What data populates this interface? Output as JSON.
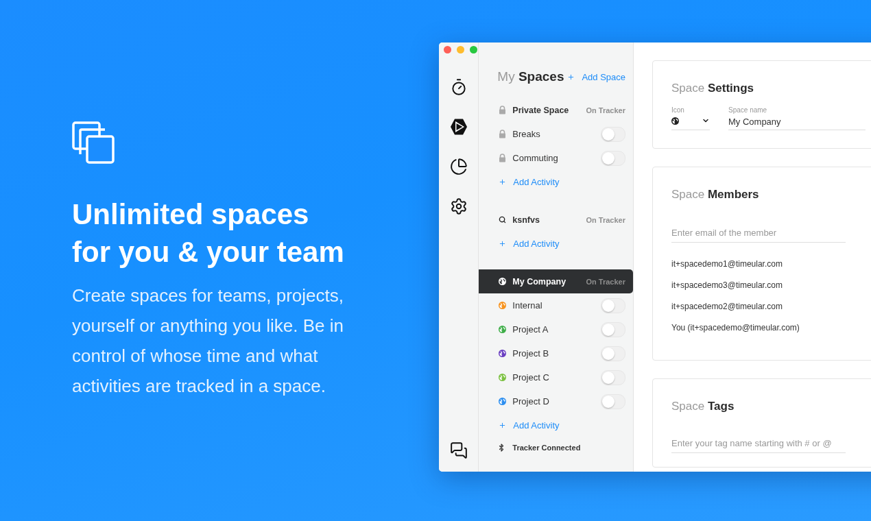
{
  "hero": {
    "heading_lines": [
      "Unlimited spaces",
      "for you & your team"
    ],
    "body": "Create spaces for teams, projects, yourself or anything you like. Be in control of whose time and what activities are tracked in a space."
  },
  "spaces_panel": {
    "title": "My **Spaces**",
    "add_space": "Add Space",
    "groups": [
      {
        "name": "Private Space",
        "kind": "lock",
        "tracker_label": "On Tracker",
        "selected": false,
        "add_label": "Add Activity",
        "activities": [
          {
            "name": "Breaks",
            "kind": "lock",
            "on": false
          },
          {
            "name": "Commuting",
            "kind": "lock",
            "on": false
          }
        ]
      },
      {
        "name": "ksnfvs",
        "kind": "search",
        "tracker_label": "On Tracker",
        "selected": false,
        "add_label": "Add Activity"
      },
      {
        "name": "My Company",
        "kind": "globe",
        "tracker_label": "On Tracker",
        "selected": true,
        "add_label": "Add Activity",
        "activities": [
          {
            "name": "Internal",
            "kind": "globe",
            "color": "#f7931e",
            "on": false
          },
          {
            "name": "Project A",
            "kind": "globe",
            "color": "#3fae49",
            "on": false
          },
          {
            "name": "Project B",
            "kind": "globe",
            "color": "#6a3fc1",
            "on": false
          },
          {
            "name": "Project C",
            "kind": "globe",
            "color": "#7cc142",
            "on": false
          },
          {
            "name": "Project D",
            "kind": "globe",
            "color": "#2d8ff0",
            "on": false
          }
        ]
      }
    ],
    "status": "Tracker Connected"
  },
  "settings_card": {
    "title": "Space **Settings**",
    "icon_label": "Icon",
    "name_label": "Space name",
    "name_value": "My Company"
  },
  "members_card": {
    "title": "Space **Members**",
    "placeholder": "Enter email of the member",
    "members": [
      "it+spacedemo1@timeular.com",
      "it+spacedemo3@timeular.com",
      "it+spacedemo2@timeular.com",
      "You (it+spacedemo@timeular.com)"
    ]
  },
  "tags_card": {
    "title": "Space **Tags**",
    "placeholder": "Enter your tag name starting with # or @"
  }
}
